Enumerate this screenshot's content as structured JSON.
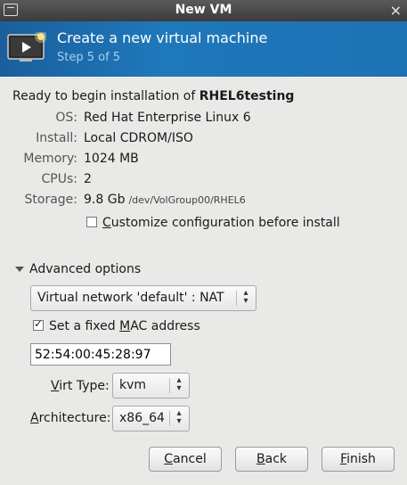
{
  "window": {
    "title": "New VM",
    "close_glyph": "×",
    "icon": "window-icon"
  },
  "banner": {
    "heading": "Create a new virtual machine",
    "step": "Step 5 of 5",
    "icon": "vm-monitor-icon",
    "color": "#1d72b3"
  },
  "summary": {
    "ready_prefix": "Ready to begin installation of ",
    "vm_name": "RHEL6testing",
    "rows": [
      {
        "label": "OS:",
        "value": "Red Hat Enterprise Linux 6"
      },
      {
        "label": "Install:",
        "value": "Local CDROM/ISO"
      },
      {
        "label": "Memory:",
        "value": "1024 MB"
      },
      {
        "label": "CPUs:",
        "value": "2"
      },
      {
        "label": "Storage:",
        "value": "9.8 Gb",
        "path": "/dev/VolGroup00/RHEL6"
      }
    ],
    "customize_label_prefix": "",
    "customize_label_accel": "C",
    "customize_label_rest": "ustomize configuration before install",
    "customize_checked": false
  },
  "advanced": {
    "label": "Advanced options",
    "expanded": true,
    "network_select": "Virtual network 'default' : NAT",
    "fixed_mac_prefix": "Set a fixed ",
    "fixed_mac_accel": "M",
    "fixed_mac_rest": "AC address",
    "fixed_mac_checked": true,
    "mac_value": "52:54:00:45:28:97",
    "virt_type_label_accel": "V",
    "virt_type_label_rest": "irt Type:",
    "virt_type_value": "kvm",
    "arch_label_accel": "A",
    "arch_label_rest": "rchitecture:",
    "arch_value": "x86_64"
  },
  "buttons": {
    "cancel_accel": "C",
    "cancel_rest": "ancel",
    "back_accel": "B",
    "back_rest": "ack",
    "finish_accel": "F",
    "finish_rest": "inish"
  }
}
